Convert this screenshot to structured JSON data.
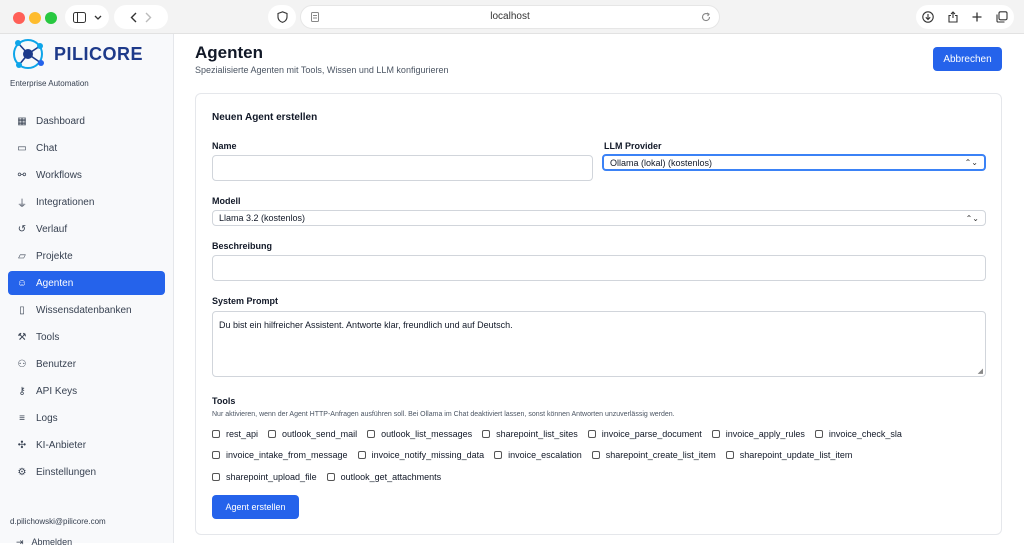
{
  "browser": {
    "url": "localhost",
    "traffic_lights": {
      "close": "#ff5f57",
      "minimize": "#febc2e",
      "zoom": "#28c840"
    }
  },
  "sidebar": {
    "brand": "PILICORE",
    "tagline": "Enterprise Automation",
    "items": [
      {
        "label": "Dashboard",
        "icon": "dashboard-icon"
      },
      {
        "label": "Chat",
        "icon": "chat-icon"
      },
      {
        "label": "Workflows",
        "icon": "workflow-icon"
      },
      {
        "label": "Integrationen",
        "icon": "plug-icon"
      },
      {
        "label": "Verlauf",
        "icon": "history-icon"
      },
      {
        "label": "Projekte",
        "icon": "folder-icon"
      },
      {
        "label": "Agenten",
        "icon": "bot-icon",
        "active": true
      },
      {
        "label": "Wissensdatenbanken",
        "icon": "book-icon"
      },
      {
        "label": "Tools",
        "icon": "wrench-icon"
      },
      {
        "label": "Benutzer",
        "icon": "users-icon"
      },
      {
        "label": "API Keys",
        "icon": "key-icon"
      },
      {
        "label": "Logs",
        "icon": "logs-icon"
      },
      {
        "label": "KI-Anbieter",
        "icon": "ai-icon"
      },
      {
        "label": "Einstellungen",
        "icon": "gear-icon"
      }
    ],
    "user_email": "d.pilichowski@pilicore.com",
    "logout": "Abmelden"
  },
  "header": {
    "title": "Agenten",
    "subtitle": "Spezialisierte Agenten mit Tools, Wissen und LLM konfigurieren",
    "cancel_label": "Abbrechen"
  },
  "form": {
    "title": "Neuen Agent erstellen",
    "name_label": "Name",
    "name_value": "",
    "provider_label": "LLM Provider",
    "provider_value": "Ollama (lokal) (kostenlos)",
    "model_label": "Modell",
    "model_value": "Llama 3.2 (kostenlos)",
    "description_label": "Beschreibung",
    "description_value": "",
    "prompt_label": "System Prompt",
    "prompt_value": "Du bist ein hilfreicher Assistent. Antworte klar, freundlich und auf Deutsch.",
    "tools_label": "Tools",
    "tools_hint": "Nur aktivieren, wenn der Agent HTTP-Anfragen ausführen soll. Bei Ollama im Chat deaktiviert lassen, sonst können Antworten unzuverlässig werden.",
    "tools": [
      [
        "rest_api",
        "outlook_send_mail",
        "outlook_list_messages",
        "sharepoint_list_sites",
        "invoice_parse_document",
        "invoice_apply_rules",
        "invoice_check_sla"
      ],
      [
        "invoice_intake_from_message",
        "invoice_notify_missing_data",
        "invoice_escalation",
        "sharepoint_create_list_item",
        "sharepoint_update_list_item"
      ],
      [
        "sharepoint_upload_file",
        "outlook_get_attachments"
      ]
    ],
    "submit_label": "Agent erstellen"
  },
  "colors": {
    "accent": "#2563eb",
    "brand": "#1e3a8a"
  }
}
